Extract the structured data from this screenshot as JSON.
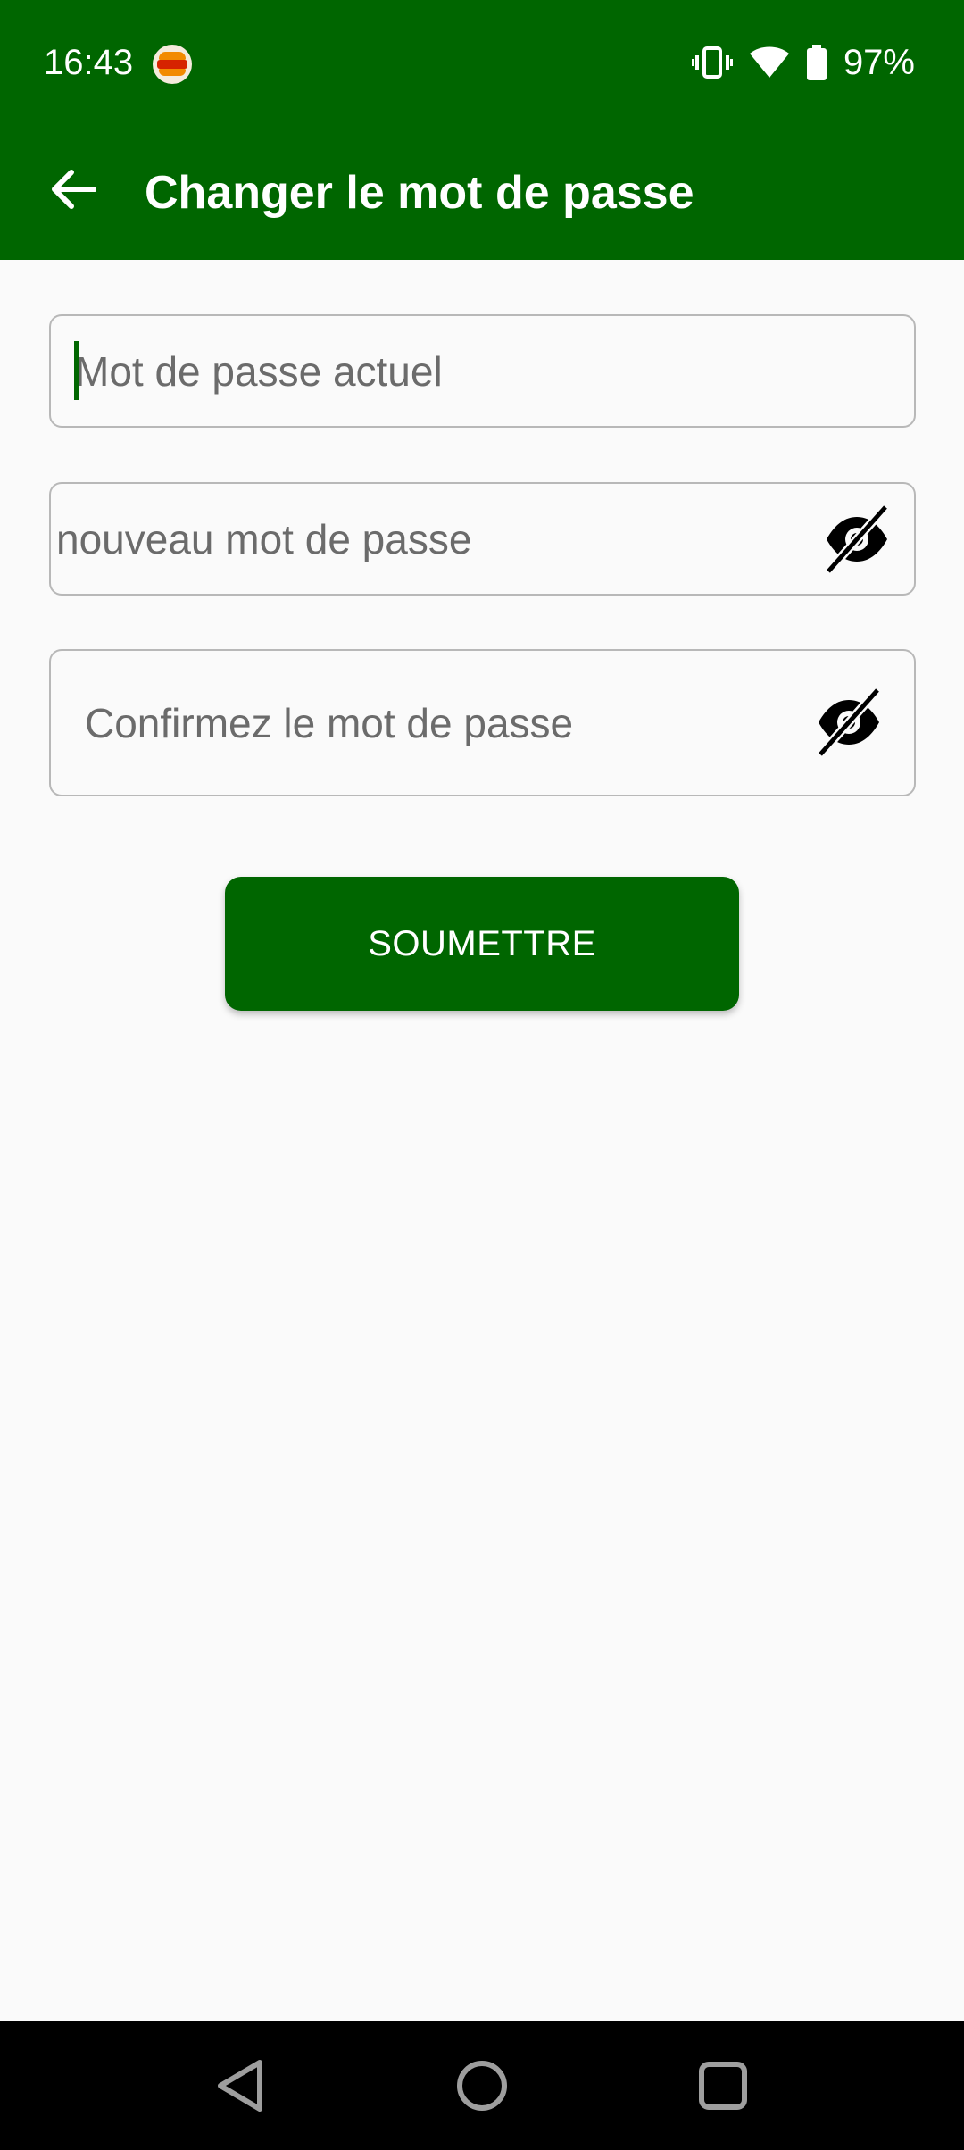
{
  "status_bar": {
    "time": "16:43",
    "battery_percent": "97%",
    "notification_icon": "burger-king-logo",
    "icons": [
      "vibrate-icon",
      "wifi-icon",
      "battery-icon"
    ]
  },
  "app_bar": {
    "title": "Changer le mot de passe",
    "back_icon": "arrow-left-icon"
  },
  "form": {
    "current_password": {
      "placeholder": "Mot de passe actuel",
      "value": ""
    },
    "new_password": {
      "placeholder": "nouveau mot de passe",
      "value": "",
      "toggle_icon": "eye-off-icon"
    },
    "confirm_password": {
      "placeholder": "Confirmez le mot de passe",
      "value": "",
      "toggle_icon": "eye-off-icon"
    },
    "submit_label": "SOUMETTRE"
  },
  "nav_bar": {
    "buttons": [
      "back-triangle-icon",
      "home-circle-icon",
      "recents-square-icon"
    ]
  },
  "colors": {
    "primary": "#006600",
    "background": "#fafafa",
    "field_border": "#b8b8b8",
    "placeholder": "#6b6b6b",
    "nav_bar": "#000000"
  }
}
